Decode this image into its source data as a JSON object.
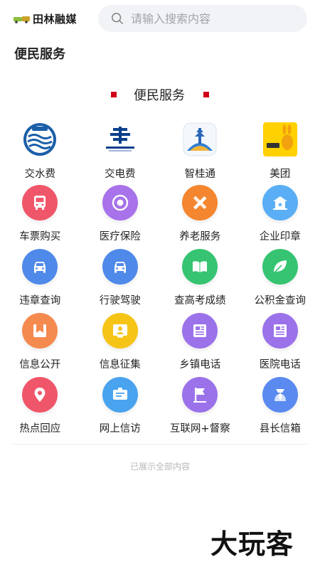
{
  "header": {
    "logo_text": "田林融媒",
    "search_placeholder": "请输入搜索内容"
  },
  "page_title": "便民服务",
  "section_title": "便民服务",
  "services": [
    {
      "label": "交水费",
      "icon": "water-bureau-logo",
      "color": "#1b5fa8"
    },
    {
      "label": "交电费",
      "icon": "southern-grid-logo",
      "color": "#0a3f8c"
    },
    {
      "label": "智桂通",
      "icon": "zhiguitong-app-logo",
      "color": "#2f7fd6"
    },
    {
      "label": "美团",
      "icon": "meituan-logo",
      "color": "#ffd100"
    },
    {
      "label": "车票购买",
      "icon": "bus-icon",
      "color": "#f0566a"
    },
    {
      "label": "医疗保险",
      "icon": "medical-insurance-icon",
      "color": "#a772ea"
    },
    {
      "label": "养老服务",
      "icon": "pencil-ruler-icon",
      "color": "#f3862f"
    },
    {
      "label": "企业印章",
      "icon": "enterprise-building-icon",
      "color": "#5aaef5"
    },
    {
      "label": "违章查询",
      "icon": "car-icon",
      "color": "#4f89ea"
    },
    {
      "label": "行驶驾驶",
      "icon": "car-icon",
      "color": "#4f89ea"
    },
    {
      "label": "查高考成绩",
      "icon": "book-icon",
      "color": "#36c472"
    },
    {
      "label": "公积金查询",
      "icon": "leaf-icon",
      "color": "#36c472"
    },
    {
      "label": "信息公开",
      "icon": "bookmark-icon",
      "color": "#f58a4f"
    },
    {
      "label": "信息征集",
      "icon": "user-board-icon",
      "color": "#f6c417"
    },
    {
      "label": "乡镇电话",
      "icon": "newspaper-icon",
      "color": "#9b72ea"
    },
    {
      "label": "医院电话",
      "icon": "newspaper-icon",
      "color": "#9b72ea"
    },
    {
      "label": "热点回应",
      "icon": "location-pin-icon",
      "color": "#f0566a"
    },
    {
      "label": "网上信访",
      "icon": "message-board-icon",
      "color": "#4aa3ee"
    },
    {
      "label": "互联网+督察",
      "icon": "flag-icon",
      "color": "#9b72ea"
    },
    {
      "label": "县长信箱",
      "icon": "person-tie-icon",
      "color": "#5a8af0"
    }
  ],
  "end_note": "已展示全部内容",
  "watermark": "大玩客"
}
